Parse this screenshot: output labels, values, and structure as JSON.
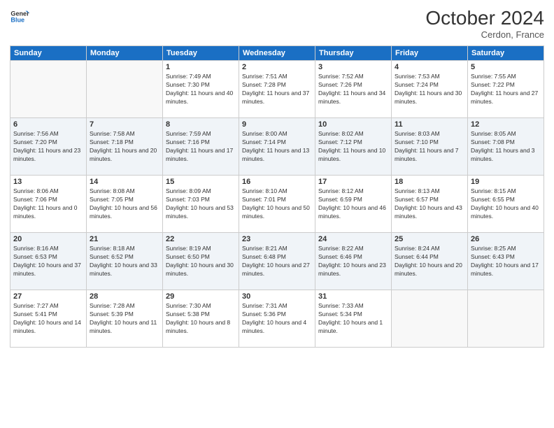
{
  "header": {
    "logo": {
      "general": "General",
      "blue": "Blue"
    },
    "title": "October 2024",
    "location": "Cerdon, France"
  },
  "weekdays": [
    "Sunday",
    "Monday",
    "Tuesday",
    "Wednesday",
    "Thursday",
    "Friday",
    "Saturday"
  ],
  "weeks": [
    [
      {
        "day": "",
        "sunrise": "",
        "sunset": "",
        "daylight": ""
      },
      {
        "day": "",
        "sunrise": "",
        "sunset": "",
        "daylight": ""
      },
      {
        "day": "1",
        "sunrise": "Sunrise: 7:49 AM",
        "sunset": "Sunset: 7:30 PM",
        "daylight": "Daylight: 11 hours and 40 minutes."
      },
      {
        "day": "2",
        "sunrise": "Sunrise: 7:51 AM",
        "sunset": "Sunset: 7:28 PM",
        "daylight": "Daylight: 11 hours and 37 minutes."
      },
      {
        "day": "3",
        "sunrise": "Sunrise: 7:52 AM",
        "sunset": "Sunset: 7:26 PM",
        "daylight": "Daylight: 11 hours and 34 minutes."
      },
      {
        "day": "4",
        "sunrise": "Sunrise: 7:53 AM",
        "sunset": "Sunset: 7:24 PM",
        "daylight": "Daylight: 11 hours and 30 minutes."
      },
      {
        "day": "5",
        "sunrise": "Sunrise: 7:55 AM",
        "sunset": "Sunset: 7:22 PM",
        "daylight": "Daylight: 11 hours and 27 minutes."
      }
    ],
    [
      {
        "day": "6",
        "sunrise": "Sunrise: 7:56 AM",
        "sunset": "Sunset: 7:20 PM",
        "daylight": "Daylight: 11 hours and 23 minutes."
      },
      {
        "day": "7",
        "sunrise": "Sunrise: 7:58 AM",
        "sunset": "Sunset: 7:18 PM",
        "daylight": "Daylight: 11 hours and 20 minutes."
      },
      {
        "day": "8",
        "sunrise": "Sunrise: 7:59 AM",
        "sunset": "Sunset: 7:16 PM",
        "daylight": "Daylight: 11 hours and 17 minutes."
      },
      {
        "day": "9",
        "sunrise": "Sunrise: 8:00 AM",
        "sunset": "Sunset: 7:14 PM",
        "daylight": "Daylight: 11 hours and 13 minutes."
      },
      {
        "day": "10",
        "sunrise": "Sunrise: 8:02 AM",
        "sunset": "Sunset: 7:12 PM",
        "daylight": "Daylight: 11 hours and 10 minutes."
      },
      {
        "day": "11",
        "sunrise": "Sunrise: 8:03 AM",
        "sunset": "Sunset: 7:10 PM",
        "daylight": "Daylight: 11 hours and 7 minutes."
      },
      {
        "day": "12",
        "sunrise": "Sunrise: 8:05 AM",
        "sunset": "Sunset: 7:08 PM",
        "daylight": "Daylight: 11 hours and 3 minutes."
      }
    ],
    [
      {
        "day": "13",
        "sunrise": "Sunrise: 8:06 AM",
        "sunset": "Sunset: 7:06 PM",
        "daylight": "Daylight: 11 hours and 0 minutes."
      },
      {
        "day": "14",
        "sunrise": "Sunrise: 8:08 AM",
        "sunset": "Sunset: 7:05 PM",
        "daylight": "Daylight: 10 hours and 56 minutes."
      },
      {
        "day": "15",
        "sunrise": "Sunrise: 8:09 AM",
        "sunset": "Sunset: 7:03 PM",
        "daylight": "Daylight: 10 hours and 53 minutes."
      },
      {
        "day": "16",
        "sunrise": "Sunrise: 8:10 AM",
        "sunset": "Sunset: 7:01 PM",
        "daylight": "Daylight: 10 hours and 50 minutes."
      },
      {
        "day": "17",
        "sunrise": "Sunrise: 8:12 AM",
        "sunset": "Sunset: 6:59 PM",
        "daylight": "Daylight: 10 hours and 46 minutes."
      },
      {
        "day": "18",
        "sunrise": "Sunrise: 8:13 AM",
        "sunset": "Sunset: 6:57 PM",
        "daylight": "Daylight: 10 hours and 43 minutes."
      },
      {
        "day": "19",
        "sunrise": "Sunrise: 8:15 AM",
        "sunset": "Sunset: 6:55 PM",
        "daylight": "Daylight: 10 hours and 40 minutes."
      }
    ],
    [
      {
        "day": "20",
        "sunrise": "Sunrise: 8:16 AM",
        "sunset": "Sunset: 6:53 PM",
        "daylight": "Daylight: 10 hours and 37 minutes."
      },
      {
        "day": "21",
        "sunrise": "Sunrise: 8:18 AM",
        "sunset": "Sunset: 6:52 PM",
        "daylight": "Daylight: 10 hours and 33 minutes."
      },
      {
        "day": "22",
        "sunrise": "Sunrise: 8:19 AM",
        "sunset": "Sunset: 6:50 PM",
        "daylight": "Daylight: 10 hours and 30 minutes."
      },
      {
        "day": "23",
        "sunrise": "Sunrise: 8:21 AM",
        "sunset": "Sunset: 6:48 PM",
        "daylight": "Daylight: 10 hours and 27 minutes."
      },
      {
        "day": "24",
        "sunrise": "Sunrise: 8:22 AM",
        "sunset": "Sunset: 6:46 PM",
        "daylight": "Daylight: 10 hours and 23 minutes."
      },
      {
        "day": "25",
        "sunrise": "Sunrise: 8:24 AM",
        "sunset": "Sunset: 6:44 PM",
        "daylight": "Daylight: 10 hours and 20 minutes."
      },
      {
        "day": "26",
        "sunrise": "Sunrise: 8:25 AM",
        "sunset": "Sunset: 6:43 PM",
        "daylight": "Daylight: 10 hours and 17 minutes."
      }
    ],
    [
      {
        "day": "27",
        "sunrise": "Sunrise: 7:27 AM",
        "sunset": "Sunset: 5:41 PM",
        "daylight": "Daylight: 10 hours and 14 minutes."
      },
      {
        "day": "28",
        "sunrise": "Sunrise: 7:28 AM",
        "sunset": "Sunset: 5:39 PM",
        "daylight": "Daylight: 10 hours and 11 minutes."
      },
      {
        "day": "29",
        "sunrise": "Sunrise: 7:30 AM",
        "sunset": "Sunset: 5:38 PM",
        "daylight": "Daylight: 10 hours and 8 minutes."
      },
      {
        "day": "30",
        "sunrise": "Sunrise: 7:31 AM",
        "sunset": "Sunset: 5:36 PM",
        "daylight": "Daylight: 10 hours and 4 minutes."
      },
      {
        "day": "31",
        "sunrise": "Sunrise: 7:33 AM",
        "sunset": "Sunset: 5:34 PM",
        "daylight": "Daylight: 10 hours and 1 minute."
      },
      {
        "day": "",
        "sunrise": "",
        "sunset": "",
        "daylight": ""
      },
      {
        "day": "",
        "sunrise": "",
        "sunset": "",
        "daylight": ""
      }
    ]
  ]
}
